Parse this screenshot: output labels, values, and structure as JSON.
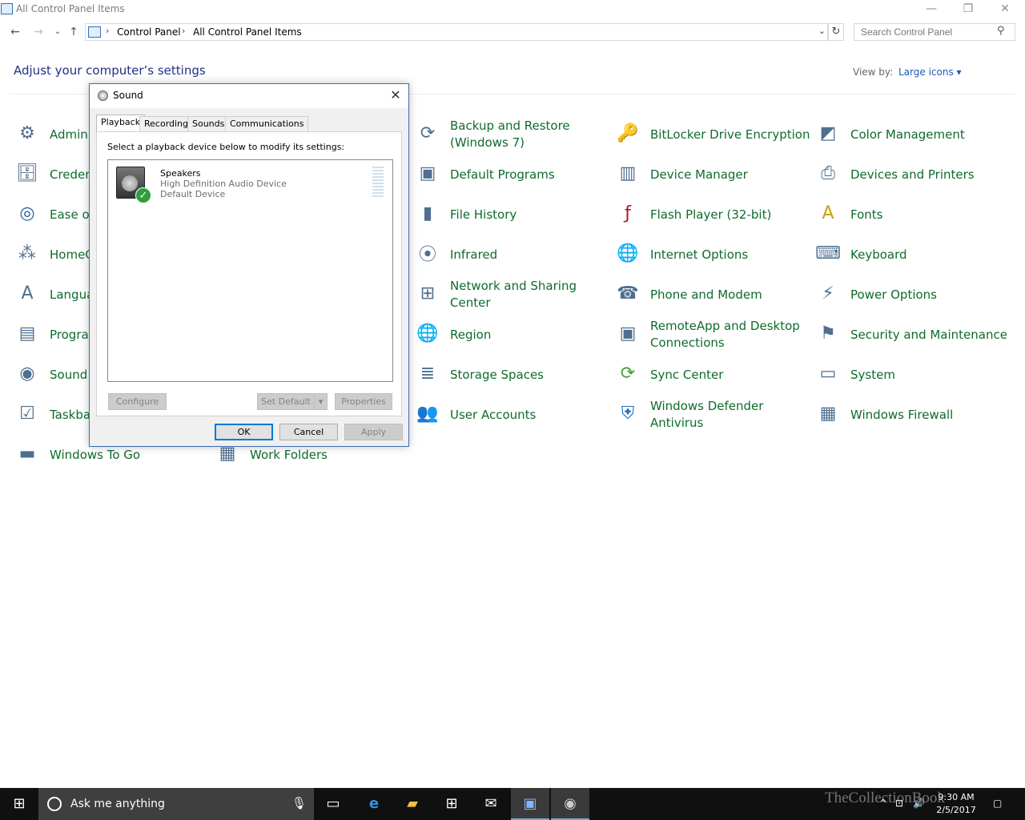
{
  "window": {
    "title": "All Control Panel Items"
  },
  "address": {
    "crumbs": [
      "Control Panel",
      "All Control Panel Items"
    ],
    "search_placeholder": "Search Control Panel"
  },
  "page": {
    "heading": "Adjust your computer’s settings",
    "view_by_label": "View by:",
    "view_by_value": "Large icons"
  },
  "items": [
    {
      "label": "Admini",
      "icon": "admin-tools-icon"
    },
    {
      "label": "Creden",
      "icon": "credential-manager-icon"
    },
    {
      "label": "Ease of",
      "icon": "ease-of-access-icon"
    },
    {
      "label": "HomeG",
      "icon": "homegroup-icon"
    },
    {
      "label": "Langua",
      "icon": "language-icon"
    },
    {
      "label": "Progra",
      "icon": "programs-icon"
    },
    {
      "label": "Sound",
      "icon": "sound-icon"
    },
    {
      "label": "Taskbar",
      "icon": "taskbar-icon"
    },
    {
      "label": "Windows To Go",
      "icon": "windows-to-go-icon"
    },
    {
      "label": "Work Folders",
      "icon": "work-folders-icon"
    },
    {
      "label": "Backup and Restore (Windows 7)",
      "icon": "backup-icon"
    },
    {
      "label": "Default Programs",
      "icon": "default-programs-icon"
    },
    {
      "label": "File History",
      "icon": "file-history-icon"
    },
    {
      "label": "Infrared",
      "icon": "infrared-icon"
    },
    {
      "label": "Network and Sharing Center",
      "icon": "network-icon"
    },
    {
      "label": "Region",
      "icon": "region-icon"
    },
    {
      "label": "Storage Spaces",
      "icon": "storage-spaces-icon"
    },
    {
      "label": "User Accounts",
      "icon": "user-accounts-icon"
    },
    {
      "label": "BitLocker Drive Encryption",
      "icon": "bitlocker-icon"
    },
    {
      "label": "Device Manager",
      "icon": "device-manager-icon"
    },
    {
      "label": "Flash Player (32-bit)",
      "icon": "flash-icon"
    },
    {
      "label": "Internet Options",
      "icon": "internet-options-icon"
    },
    {
      "label": "Phone and Modem",
      "icon": "phone-modem-icon"
    },
    {
      "label": "RemoteApp and Desktop Connections",
      "icon": "remoteapp-icon"
    },
    {
      "label": "Sync Center",
      "icon": "sync-center-icon"
    },
    {
      "label": "Windows Defender Antivirus",
      "icon": "defender-icon"
    },
    {
      "label": "Color Management",
      "icon": "color-management-icon"
    },
    {
      "label": "Devices and Printers",
      "icon": "devices-printers-icon"
    },
    {
      "label": "Fonts",
      "icon": "fonts-icon"
    },
    {
      "label": "Keyboard",
      "icon": "keyboard-icon"
    },
    {
      "label": "Power Options",
      "icon": "power-options-icon"
    },
    {
      "label": "Security and Maintenance",
      "icon": "security-maintenance-icon"
    },
    {
      "label": "System",
      "icon": "system-icon"
    },
    {
      "label": "Windows Firewall",
      "icon": "firewall-icon"
    }
  ],
  "dialog": {
    "title": "Sound",
    "tabs": [
      "Playback",
      "Recording",
      "Sounds",
      "Communications"
    ],
    "instruction": "Select a playback device below to modify its settings:",
    "device": {
      "name": "Speakers",
      "description": "High Definition Audio Device",
      "status": "Default Device"
    },
    "buttons": {
      "configure": "Configure",
      "set_default": "Set Default",
      "properties": "Properties",
      "ok": "OK",
      "cancel": "Cancel",
      "apply": "Apply"
    }
  },
  "taskbar": {
    "search_placeholder": "Ask me anything",
    "time": "9:30 AM",
    "date": "2/5/2017",
    "watermark": "TheCollectionBook"
  },
  "colors": {
    "link_green": "#0f6b2b",
    "heading_blue": "#1e3287",
    "accent": "#0078d7"
  }
}
